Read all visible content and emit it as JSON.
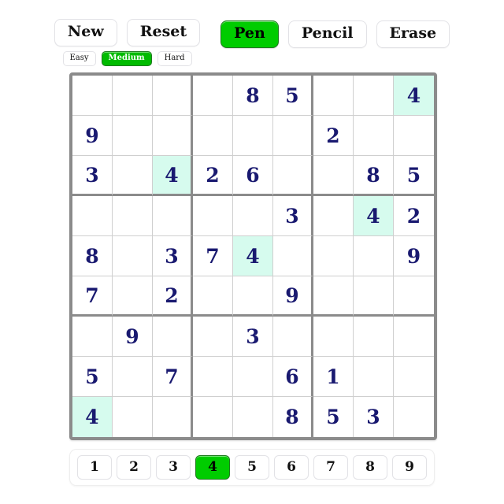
{
  "toolbar": {
    "new_label": "New",
    "reset_label": "Reset",
    "difficulties": [
      {
        "label": "Easy",
        "selected": false
      },
      {
        "label": "Medium",
        "selected": true
      },
      {
        "label": "Hard",
        "selected": false
      }
    ],
    "modes": [
      {
        "label": "Pen",
        "selected": true
      },
      {
        "label": "Pencil",
        "selected": false
      },
      {
        "label": "Erase",
        "selected": false
      }
    ]
  },
  "board": {
    "selected_number": "4",
    "highlight_color": "#d6fbee",
    "digit_color": "#191970",
    "grid_line_color": "#8b8b8b",
    "rows": [
      [
        "",
        "",
        "",
        "",
        "8",
        "5",
        "",
        "",
        "4"
      ],
      [
        "9",
        "",
        "",
        "",
        "",
        "",
        "2",
        "",
        ""
      ],
      [
        "3",
        "",
        "4",
        "2",
        "6",
        "",
        "",
        "8",
        "5"
      ],
      [
        "",
        "",
        "",
        "",
        "",
        "3",
        "",
        "4",
        "2"
      ],
      [
        "8",
        "",
        "3",
        "7",
        "4",
        "",
        "",
        "",
        "9"
      ],
      [
        "7",
        "",
        "2",
        "",
        "",
        "9",
        "",
        "",
        ""
      ],
      [
        "",
        "9",
        "",
        "",
        "3",
        "",
        "",
        "",
        ""
      ],
      [
        "5",
        "",
        "7",
        "",
        "",
        "6",
        "1",
        "",
        ""
      ],
      [
        "4",
        "",
        "",
        "",
        "",
        "8",
        "5",
        "3",
        ""
      ]
    ]
  },
  "numberpad": {
    "buttons": [
      {
        "label": "1",
        "selected": false
      },
      {
        "label": "2",
        "selected": false
      },
      {
        "label": "3",
        "selected": false
      },
      {
        "label": "4",
        "selected": true
      },
      {
        "label": "5",
        "selected": false
      },
      {
        "label": "6",
        "selected": false
      },
      {
        "label": "7",
        "selected": false
      },
      {
        "label": "8",
        "selected": false
      },
      {
        "label": "9",
        "selected": false
      }
    ]
  }
}
